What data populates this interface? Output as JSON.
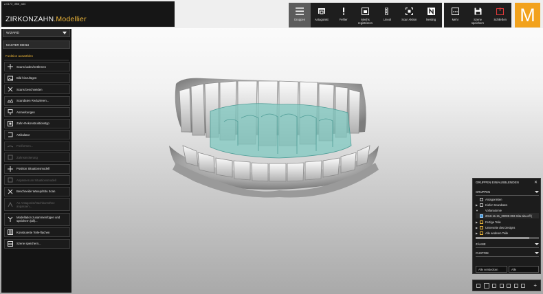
{
  "window": {
    "caption": "z-0173_dfbb_a64"
  },
  "app": {
    "name": "ZIRKONZAHN",
    "name_suffix": ".Modellier",
    "logo_letter": "M",
    "accent_color": "#f0b83a",
    "logo_color": "#f2a21d"
  },
  "toolbar": {
    "buttons": [
      {
        "label": "Gruppen",
        "icon": "menu-lines-icon",
        "active": true
      },
      {
        "label": "Antagonist",
        "icon": "antagonist-icon"
      },
      {
        "label": "Fehler",
        "icon": "exclamation-icon"
      },
      {
        "label": "Meshs\nregistrieren",
        "icon": "mesh-register-icon"
      },
      {
        "label": "Lineal",
        "icon": "ruler-icon"
      },
      {
        "label": "Scan Aktion",
        "icon": "scan-action-icon"
      },
      {
        "label": "Nesting",
        "icon": "nesting-icon"
      }
    ],
    "right_buttons": [
      {
        "label": "Mehr",
        "icon": "more-icon"
      },
      {
        "label": "Szene\nspeichern",
        "icon": "save-icon"
      },
      {
        "label": "Schließen",
        "icon": "power-icon"
      }
    ]
  },
  "sidebar": {
    "wizard_label": "WIZARD",
    "master_label": "MASTER MENU",
    "section_title": "Funktion auswählen",
    "items": [
      {
        "label": "Scans laden/entfernen",
        "icon": "scan-load-icon"
      },
      {
        "label": "Bild hinzufügen",
        "icon": "image-add-icon"
      },
      {
        "label": "Scans beschneiden",
        "icon": "scissors-icon"
      },
      {
        "label": "Scandaten Reduzieren...",
        "icon": "reduce-icon"
      },
      {
        "label": "Anmerkungen",
        "icon": "annotation-icon"
      },
      {
        "label": "Zahn-Rekonstruktionstyp",
        "icon": "tooth-type-icon"
      },
      {
        "label": "Artikulator",
        "icon": "articulator-icon"
      },
      {
        "label": "Freiformen...",
        "icon": "freeform-icon",
        "disabled": true
      },
      {
        "label": "Zahnsteckerung",
        "icon": "tooth-plug-icon",
        "disabled": true
      },
      {
        "label": "Position Situationsmodell",
        "icon": "position-icon"
      },
      {
        "label": "Anpassen an Situationsmodell",
        "icon": "adapt-icon",
        "disabled": true
      },
      {
        "label": "Beschneide Waxup/Situ Scan",
        "icon": "scissors-icon"
      },
      {
        "label": "An Antagonist/Nachbarzähne anpassen...",
        "icon": "adapt-antagonist-icon",
        "disabled": true,
        "tall": true
      },
      {
        "label": "Modellation zusammenfügen und speichern (all)...",
        "icon": "merge-icon",
        "tall": true
      },
      {
        "label": "Konstruierte Teile-flachen",
        "icon": "construct-icon"
      },
      {
        "label": "Szene speichern...",
        "icon": "scene-save-icon"
      }
    ]
  },
  "groups_panel": {
    "title": "GRUPPEN EIN/AUSBLENDEN",
    "section_groups": "GRUPPEN",
    "rows": [
      {
        "label": "Antagonisten",
        "arrow": "",
        "box": "plain"
      },
      {
        "label": "Kiefer-Scandaten",
        "arrow": "▶",
        "box": "plain"
      },
      {
        "label": "Vollanatomie",
        "arrow": "▼",
        "box": "none"
      },
      {
        "label": "2016-11-21_00009-002-Situ-situ.off (",
        "arrow": "",
        "box": "sel"
      },
      {
        "label": "Fertige Teile",
        "arrow": "▶",
        "box": "orange"
      },
      {
        "label": "Unterseite des Designs",
        "arrow": "▶",
        "box": "orange"
      },
      {
        "label": "Alle anderen Teile",
        "arrow": "▶",
        "box": "orange"
      }
    ],
    "section_teeth": "ZÄHNE",
    "section_custom": "CUSTOM",
    "hide_all": "Alle verstecken",
    "all": "Alle"
  },
  "viewport": {
    "model_color": "#7fc8c0",
    "model_description": ""
  }
}
